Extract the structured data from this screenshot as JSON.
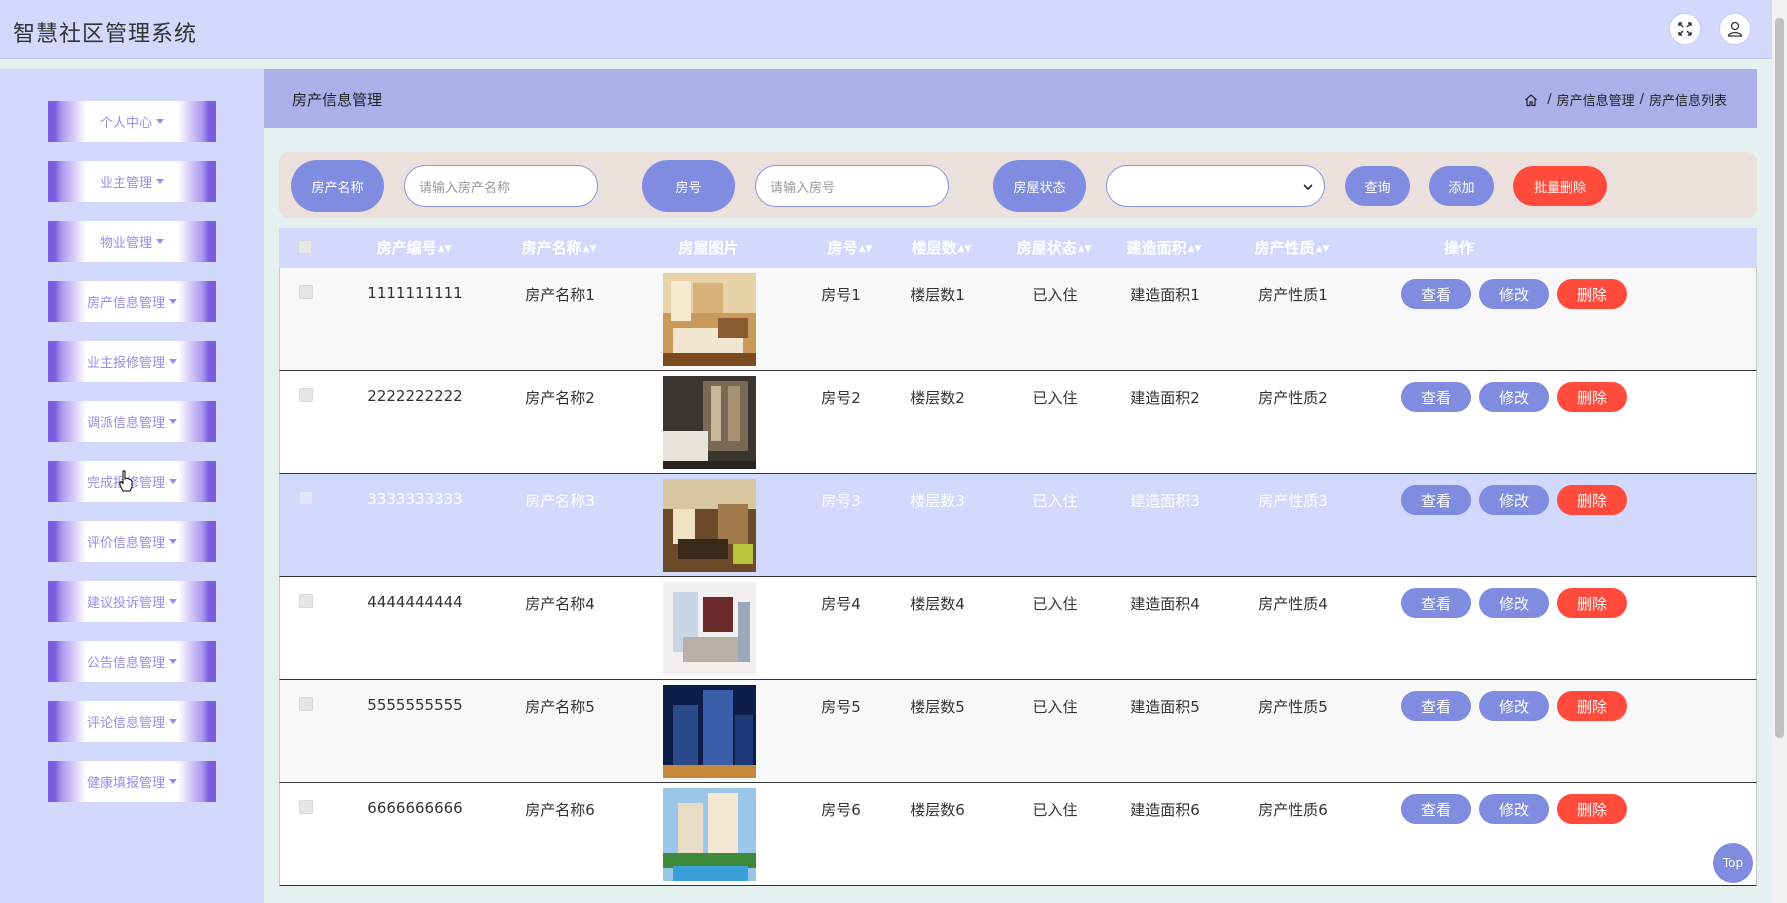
{
  "app": {
    "title": "智慧社区管理系统"
  },
  "header_icons": [
    "fullscreen-icon",
    "user-icon"
  ],
  "sidebar": {
    "items": [
      {
        "label": "个人中心"
      },
      {
        "label": "业主管理"
      },
      {
        "label": "物业管理"
      },
      {
        "label": "房产信息管理"
      },
      {
        "label": "业主报修管理"
      },
      {
        "label": "调派信息管理"
      },
      {
        "label": "完成报修管理"
      },
      {
        "label": "评价信息管理"
      },
      {
        "label": "建议投诉管理"
      },
      {
        "label": "公告信息管理"
      },
      {
        "label": "评论信息管理"
      },
      {
        "label": "健康填报管理"
      }
    ]
  },
  "page": {
    "title": "房产信息管理",
    "breadcrumb": [
      "房产信息管理",
      "房产信息列表"
    ]
  },
  "search": {
    "name_label": "房产名称",
    "name_placeholder": "请输入房产名称",
    "room_label": "房号",
    "room_placeholder": "请输入房号",
    "status_label": "房屋状态",
    "status_value": "",
    "query_button": "查询",
    "add_button": "添加",
    "batch_delete_button": "批量删除"
  },
  "table": {
    "columns": [
      "房产编号",
      "房产名称",
      "房屋图片",
      "房号",
      "楼层数",
      "房屋状态",
      "建造面积",
      "房产性质",
      "操作"
    ],
    "actions": {
      "view": "查看",
      "edit": "修改",
      "delete": "删除"
    },
    "rows": [
      {
        "id": "1111111111",
        "name": "房产名称1",
        "room": "房号1",
        "floors": "楼层数1",
        "status": "已入住",
        "area": "建造面积1",
        "nature": "房产性质1"
      },
      {
        "id": "2222222222",
        "name": "房产名称2",
        "room": "房号2",
        "floors": "楼层数2",
        "status": "已入住",
        "area": "建造面积2",
        "nature": "房产性质2"
      },
      {
        "id": "3333333333",
        "name": "房产名称3",
        "room": "房号3",
        "floors": "楼层数3",
        "status": "已入住",
        "area": "建造面积3",
        "nature": "房产性质3"
      },
      {
        "id": "4444444444",
        "name": "房产名称4",
        "room": "房号4",
        "floors": "楼层数4",
        "status": "已入住",
        "area": "建造面积4",
        "nature": "房产性质4"
      },
      {
        "id": "5555555555",
        "name": "房产名称5",
        "room": "房号5",
        "floors": "楼层数5",
        "status": "已入住",
        "area": "建造面积5",
        "nature": "房产性质5"
      },
      {
        "id": "6666666666",
        "name": "房产名称6",
        "room": "房号6",
        "floors": "楼层数6",
        "status": "已入住",
        "area": "建造面积6",
        "nature": "房产性质6"
      }
    ]
  },
  "top_button": "Top",
  "colors": {
    "accent": "#7f8ce0",
    "danger": "#ff4a3c",
    "header_bg": "#d3d8fd",
    "breadbar_bg": "#a9b0ea",
    "sidebar_purple": "#7b5dde"
  }
}
